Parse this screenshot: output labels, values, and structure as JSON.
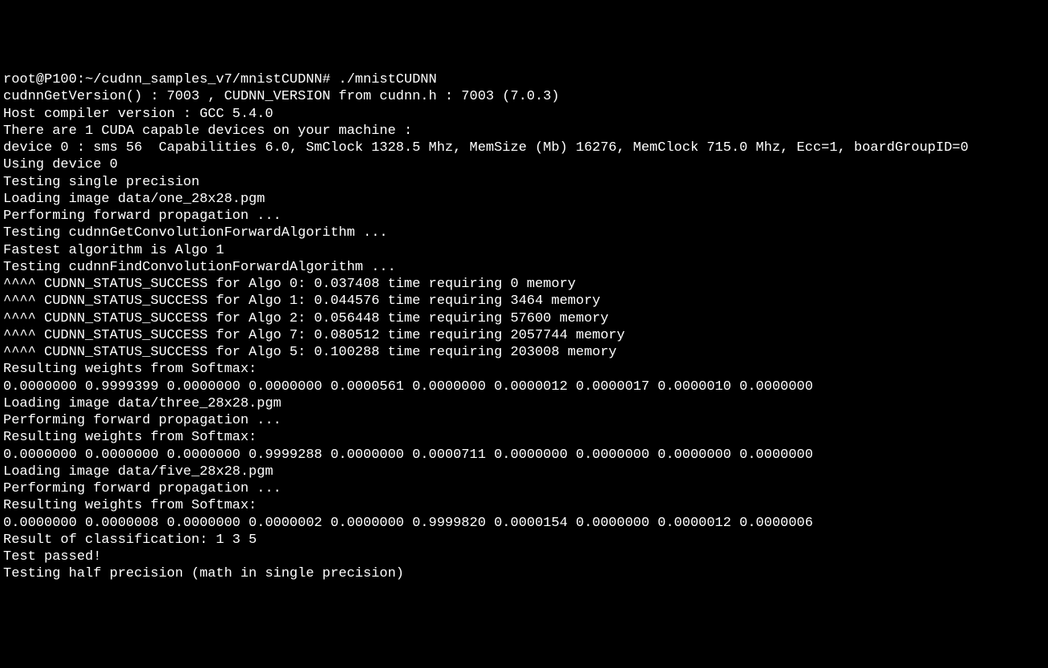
{
  "terminal": {
    "prompt_host": "root@P100",
    "prompt_path": "~/cudnn_samples_v7/mnistCUDNN",
    "prompt_suffix": "#",
    "command": "./mnistCUDNN",
    "lines": [
      "root@P100:~/cudnn_samples_v7/mnistCUDNN# ./mnistCUDNN",
      "cudnnGetVersion() : 7003 , CUDNN_VERSION from cudnn.h : 7003 (7.0.3)",
      "Host compiler version : GCC 5.4.0",
      "There are 1 CUDA capable devices on your machine :",
      "device 0 : sms 56  Capabilities 6.0, SmClock 1328.5 Mhz, MemSize (Mb) 16276, MemClock 715.0 Mhz, Ecc=1, boardGroupID=0",
      "Using device 0",
      "",
      "Testing single precision",
      "Loading image data/one_28x28.pgm",
      "Performing forward propagation ...",
      "Testing cudnnGetConvolutionForwardAlgorithm ...",
      "Fastest algorithm is Algo 1",
      "Testing cudnnFindConvolutionForwardAlgorithm ...",
      "^^^^ CUDNN_STATUS_SUCCESS for Algo 0: 0.037408 time requiring 0 memory",
      "^^^^ CUDNN_STATUS_SUCCESS for Algo 1: 0.044576 time requiring 3464 memory",
      "^^^^ CUDNN_STATUS_SUCCESS for Algo 2: 0.056448 time requiring 57600 memory",
      "^^^^ CUDNN_STATUS_SUCCESS for Algo 7: 0.080512 time requiring 2057744 memory",
      "^^^^ CUDNN_STATUS_SUCCESS for Algo 5: 0.100288 time requiring 203008 memory",
      "Resulting weights from Softmax:",
      "0.0000000 0.9999399 0.0000000 0.0000000 0.0000561 0.0000000 0.0000012 0.0000017 0.0000010 0.0000000",
      "Loading image data/three_28x28.pgm",
      "Performing forward propagation ...",
      "Resulting weights from Softmax:",
      "0.0000000 0.0000000 0.0000000 0.9999288 0.0000000 0.0000711 0.0000000 0.0000000 0.0000000 0.0000000",
      "Loading image data/five_28x28.pgm",
      "Performing forward propagation ...",
      "Resulting weights from Softmax:",
      "0.0000000 0.0000008 0.0000000 0.0000002 0.0000000 0.9999820 0.0000154 0.0000000 0.0000012 0.0000006",
      "",
      "Result of classification: 1 3 5",
      "",
      "Test passed!",
      "",
      "Testing half precision (math in single precision)"
    ]
  },
  "cudnn": {
    "get_version": "7003",
    "header_version": "7003",
    "version_string": "7.0.3",
    "compiler": "GCC 5.4.0"
  },
  "device": {
    "count": 1,
    "id": 0,
    "sms": 56,
    "capabilities": "6.0",
    "sm_clock_mhz": 1328.5,
    "mem_size_mb": 16276,
    "mem_clock_mhz": 715.0,
    "ecc": 1,
    "board_group_id": 0
  },
  "tests": {
    "precision_single": {
      "images": [
        {
          "path": "data/one_28x28.pgm",
          "algo_results": [
            {
              "algo": 0,
              "time": 0.037408,
              "memory": 0,
              "status": "CUDNN_STATUS_SUCCESS"
            },
            {
              "algo": 1,
              "time": 0.044576,
              "memory": 3464,
              "status": "CUDNN_STATUS_SUCCESS"
            },
            {
              "algo": 2,
              "time": 0.056448,
              "memory": 57600,
              "status": "CUDNN_STATUS_SUCCESS"
            },
            {
              "algo": 7,
              "time": 0.080512,
              "memory": 2057744,
              "status": "CUDNN_STATUS_SUCCESS"
            },
            {
              "algo": 5,
              "time": 0.100288,
              "memory": 203008,
              "status": "CUDNN_STATUS_SUCCESS"
            }
          ],
          "fastest_algo": 1,
          "softmax": [
            0.0,
            0.9999399,
            0.0,
            0.0,
            5.61e-05,
            0.0,
            1.2e-06,
            1.7e-06,
            1e-06,
            0.0
          ]
        },
        {
          "path": "data/three_28x28.pgm",
          "softmax": [
            0.0,
            0.0,
            0.0,
            0.9999288,
            0.0,
            7.11e-05,
            0.0,
            0.0,
            0.0,
            0.0
          ]
        },
        {
          "path": "data/five_28x28.pgm",
          "softmax": [
            0.0,
            8e-07,
            0.0,
            2e-07,
            0.0,
            0.999982,
            1.54e-05,
            0.0,
            1.2e-06,
            6e-07
          ]
        }
      ],
      "classification_result": [
        1,
        3,
        5
      ],
      "passed": true
    },
    "precision_half_note": "math in single precision"
  }
}
